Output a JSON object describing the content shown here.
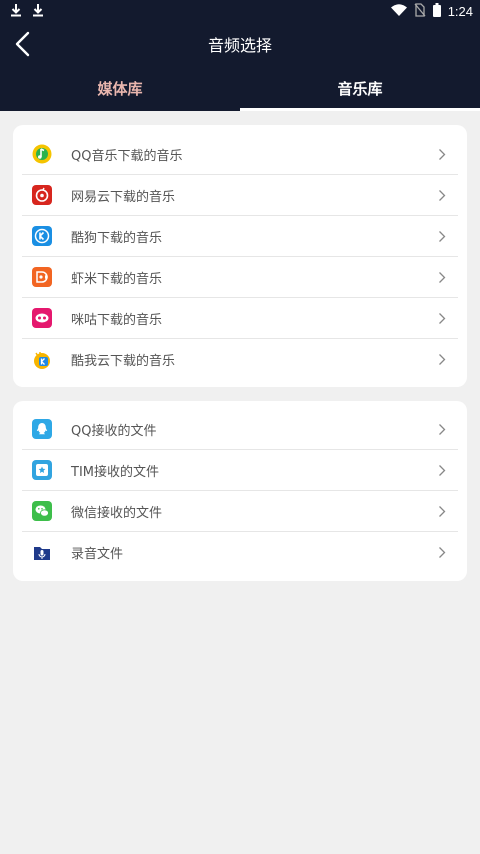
{
  "status_bar": {
    "time": "1:24"
  },
  "header": {
    "title": "音频选择"
  },
  "tabs": [
    {
      "label": "媒体库",
      "active": false
    },
    {
      "label": "音乐库",
      "active": true
    }
  ],
  "app_sources": [
    {
      "label": "QQ音乐下载的音乐",
      "icon": "qq-music-icon"
    },
    {
      "label": "网易云下载的音乐",
      "icon": "netease-cloud-music-icon"
    },
    {
      "label": "酷狗下载的音乐",
      "icon": "kugou-icon"
    },
    {
      "label": "虾米下载的音乐",
      "icon": "xiami-icon"
    },
    {
      "label": "咪咕下载的音乐",
      "icon": "migu-icon"
    },
    {
      "label": "酷我云下载的音乐",
      "icon": "kuwo-icon"
    }
  ],
  "file_sources": [
    {
      "label": "QQ接收的文件",
      "icon": "qq-icon"
    },
    {
      "label": "TIM接收的文件",
      "icon": "tim-icon"
    },
    {
      "label": "微信接收的文件",
      "icon": "wechat-icon"
    },
    {
      "label": "录音文件",
      "icon": "recording-icon"
    }
  ],
  "colors": {
    "header_bg": "#131a2e",
    "inactive_tab": "#e9b6ae",
    "page_bg": "#f0f0f0"
  }
}
